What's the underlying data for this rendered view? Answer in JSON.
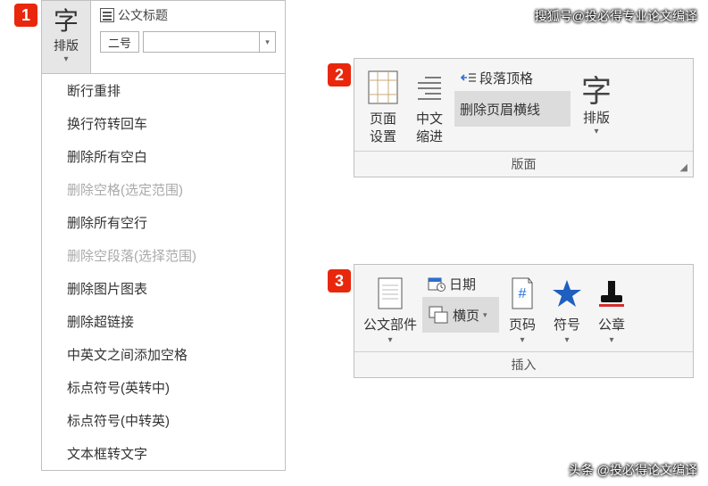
{
  "watermark": {
    "top": "搜狐号@投必得专业论文编译",
    "bottom": "头条 @投必得论文编译"
  },
  "badges": {
    "b1": "1",
    "b2": "2",
    "b3": "3"
  },
  "panel1": {
    "button": {
      "glyph": "字",
      "label": "排版"
    },
    "docTitleLabel": "公文标题",
    "fontSize": "二号",
    "menu": [
      {
        "label": "断行重排",
        "disabled": false
      },
      {
        "label": "换行符转回车",
        "disabled": false
      },
      {
        "label": "删除所有空白",
        "disabled": false
      },
      {
        "label": "删除空格(选定范围)",
        "disabled": true
      },
      {
        "label": "删除所有空行",
        "disabled": false
      },
      {
        "label": "删除空段落(选择范围)",
        "disabled": true
      },
      {
        "label": "删除图片图表",
        "disabled": false
      },
      {
        "label": "删除超链接",
        "disabled": false
      },
      {
        "label": "中英文之间添加空格",
        "disabled": false
      },
      {
        "label": "标点符号(英转中)",
        "disabled": false
      },
      {
        "label": "标点符号(中转英)",
        "disabled": false
      },
      {
        "label": "文本框转文字",
        "disabled": false
      }
    ]
  },
  "panel2": {
    "items": {
      "pageSetup": "页面\n设置",
      "cnIndent": "中文\n缩进",
      "paraTop": "段落顶格",
      "delHeaderLine": "删除页眉横线",
      "typeset": {
        "glyph": "字",
        "label": "排版"
      }
    },
    "groupLabel": "版面"
  },
  "panel3": {
    "items": {
      "docParts": "公文部件",
      "date": "日期",
      "landscape": "横页",
      "pageNum": "页码",
      "symbol": "符号",
      "seal": "公章"
    },
    "groupLabel": "插入"
  }
}
